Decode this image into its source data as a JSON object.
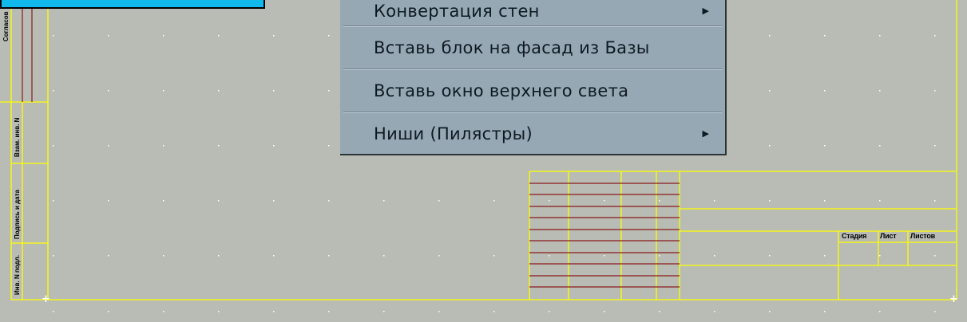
{
  "drawing": {
    "side_stamp_top": "Согласов",
    "side_stamp_labels": [
      "Взам. инв. N",
      "Подпись и дата",
      "Инв. N подл."
    ],
    "title_block_headers": [
      "Стадия",
      "Лист",
      "Листов"
    ]
  },
  "context_menu": {
    "items": [
      {
        "label": "Конвертация стен",
        "has_submenu": true
      },
      {
        "label": "Вставь блок на фасад из Базы",
        "has_submenu": false
      },
      {
        "label": "Вставь окно верхнего света",
        "has_submenu": false
      },
      {
        "label": "Ниши (Пилястры)",
        "has_submenu": true
      }
    ],
    "submenu_arrow": "▶"
  },
  "colors": {
    "background": "#b8bcb4",
    "frame_line": "#ffff00",
    "table_line": "#8b1a1a",
    "menu_bg": "#95a8b4",
    "tooltip_bg": "#10b8ec"
  }
}
